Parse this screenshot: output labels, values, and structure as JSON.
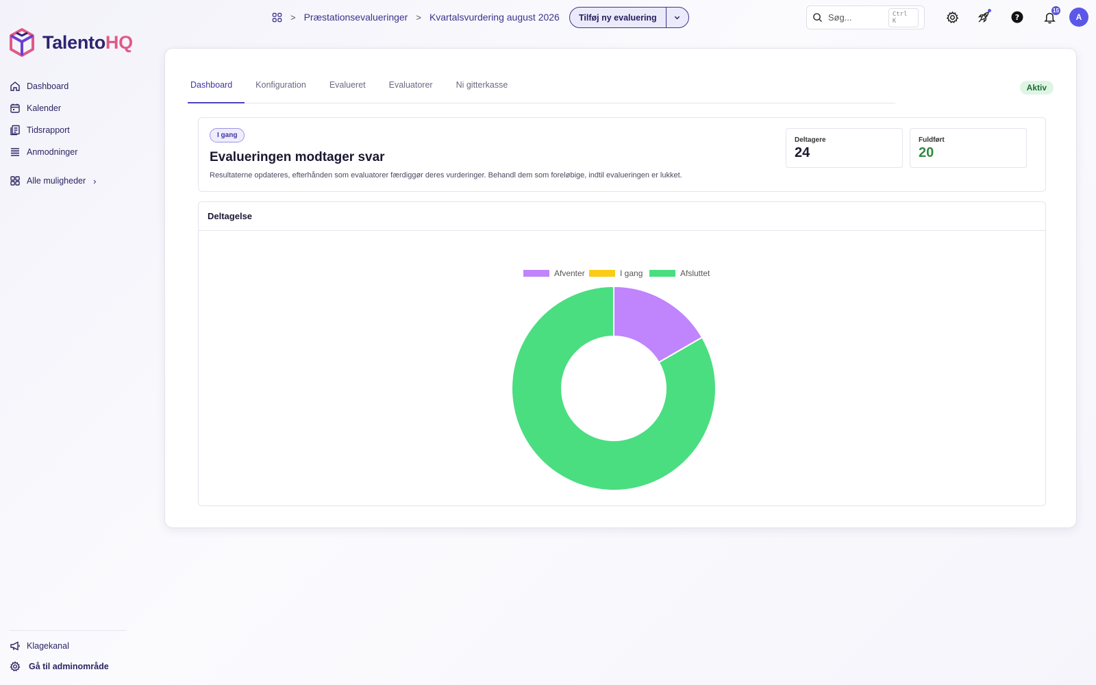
{
  "app": {
    "logo_part1": "Talento",
    "logo_part2": "HQ"
  },
  "sidebar": {
    "items": [
      {
        "label": "Dashboard",
        "icon": "home-icon"
      },
      {
        "label": "Kalender",
        "icon": "calendar-icon"
      },
      {
        "label": "Tidsrapport",
        "icon": "timesheet-icon"
      },
      {
        "label": "Anmodninger",
        "icon": "list-icon"
      }
    ],
    "more_label": "Alle muligheder",
    "bottom": [
      {
        "label": "Klagekanal",
        "icon": "megaphone-icon"
      },
      {
        "label": "Gå til adminområde",
        "icon": "gear-icon"
      }
    ]
  },
  "header": {
    "breadcrumb": [
      "Præstationsevalueringer",
      "Kvartalsvurdering august 2026"
    ],
    "add_button": "Tilføj ny evaluering",
    "search_placeholder": "Søg...",
    "search_shortcut": "Ctrl K",
    "notification_count": "15",
    "avatar_initial": "A"
  },
  "tabs": [
    "Dashboard",
    "Konfiguration",
    "Evalueret",
    "Evaluatorer",
    "Ni gitterkasse"
  ],
  "active_tab": "Dashboard",
  "status_badge": "Aktiv",
  "status_card": {
    "pill": "I gang",
    "title": "Evalueringen modtager svar",
    "description": "Resultaterne opdateres, efterhånden som evaluatorer færdiggør deres vurderinger. Behandl dem som foreløbige, indtil evalueringen er lukket.",
    "stats": [
      {
        "label": "Deltagere",
        "value": "24"
      },
      {
        "label": "Fuldført",
        "value": "20"
      }
    ]
  },
  "chart_card": {
    "title": "Deltagelse"
  },
  "colors": {
    "brand": "#2d2370",
    "accent": "#e05a86",
    "primary": "#3d36a3"
  },
  "chart_data": {
    "type": "pie",
    "variant": "doughnut",
    "categories": [
      "Afventer",
      "I gang",
      "Afsluttet"
    ],
    "values": [
      4,
      0,
      20
    ],
    "colors": [
      "#c084fc",
      "#facc15",
      "#4ade80"
    ],
    "legend": "top"
  }
}
